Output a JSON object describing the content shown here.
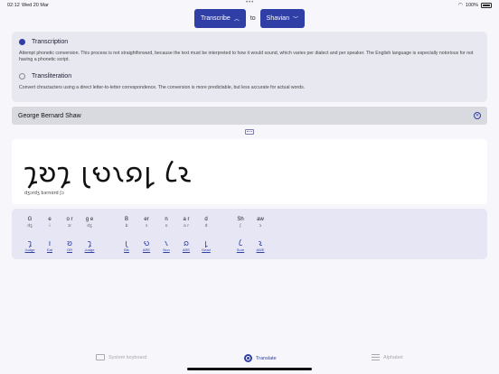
{
  "status": {
    "time": "02:12",
    "date": "Wed 20 Mar",
    "battery": "100%"
  },
  "top": {
    "from_label": "Transcribe",
    "to_text": "to",
    "target_label": "Shavian"
  },
  "options": [
    {
      "title": "Transcription",
      "description": "Attempt phonetic conversion. This process is not straightforward, because the text must be interpreted to how it would sound, which varies per dialect and per speaker. The English language is especially notorious for not having a phonetic script.",
      "selected": true
    },
    {
      "title": "Transliteration",
      "description": "Convert chractacters using a direct letter-to-letter correspondence. The conversion is more predictable, but less accurate for actual words.",
      "selected": false
    }
  ],
  "input": {
    "value": "George Bernard Shaw"
  },
  "output": {
    "shavian": "𐑡𐑹𐑡 𐑚𐑻𐑯𐑸𐑛 𐑖𐑷",
    "ipa": "dʒɔrdʒ bɜrnɑrd ʃɔ"
  },
  "breakdown": {
    "groups": [
      [
        {
          "letters": "G",
          "phoneme": "dʒ",
          "shavian": "𐑡",
          "word": "Judge"
        },
        {
          "letters": "e",
          "phoneme": "i",
          "shavian": "𐑦",
          "word": "Eat"
        },
        {
          "letters": "o r",
          "phoneme": "ɔr",
          "shavian": "𐑹",
          "word": "OR"
        },
        {
          "letters": "g e",
          "phoneme": "dʒ",
          "shavian": "𐑡",
          "word": "Judge"
        }
      ],
      [
        {
          "letters": "B",
          "phoneme": "b",
          "shavian": "𐑚",
          "word": "Bib"
        },
        {
          "letters": "er",
          "phoneme": "ɜ",
          "shavian": "𐑻",
          "word": "ARE"
        },
        {
          "letters": "n",
          "phoneme": "n",
          "shavian": "𐑯",
          "word": "Nun"
        },
        {
          "letters": "a r",
          "phoneme": "ɑ r",
          "shavian": "𐑸",
          "word": "ARE"
        },
        {
          "letters": "d",
          "phoneme": "d",
          "shavian": "𐑛",
          "word": "Dead"
        }
      ],
      [
        {
          "letters": "Sh",
          "phoneme": "ʃ",
          "shavian": "𐑖",
          "word": "Sure"
        },
        {
          "letters": "aw",
          "phoneme": "ɔ",
          "shavian": "𐑷",
          "word": "AWE"
        }
      ]
    ]
  },
  "tabs": [
    {
      "label": "System keyboard",
      "icon": "keyboard-icon"
    },
    {
      "label": "Translate",
      "icon": "translate-icon"
    },
    {
      "label": "Alphabet",
      "icon": "list-icon"
    }
  ],
  "colors": {
    "accent": "#2f3fa6",
    "background": "#f6f6fb"
  }
}
